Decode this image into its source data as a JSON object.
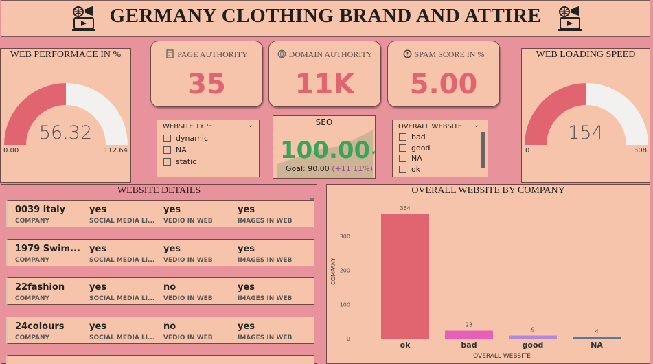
{
  "header": {
    "title": "GERMANY CLOTHING BRAND AND ATTIRE",
    "left_icon": "web-marketing-icon",
    "right_icon": "web-marketing-icon"
  },
  "web_performance": {
    "title": "WEB PERFORMACE IN %",
    "value": "56.32",
    "fraction": 0.5,
    "min": "0.00",
    "max": "112.64"
  },
  "web_loading": {
    "title": "WEB LOADING SPEED",
    "value": "154",
    "fraction": 0.5,
    "min": "0",
    "max": "308"
  },
  "kpis": [
    {
      "label": "PAGE AUTHORITY",
      "value": "35",
      "icon": "page-icon"
    },
    {
      "label": "DOMAIN AUTHORITY",
      "value": "11K",
      "icon": "globe-icon"
    },
    {
      "label": "SPAM SCORE IN %",
      "value": "5.00",
      "icon": "alert-icon"
    }
  ],
  "website_type": {
    "title": "WEBSITE TYPE",
    "options": [
      "dynamic",
      "NA",
      "static"
    ]
  },
  "overall_website": {
    "title": "OVERALL WEBSITE",
    "options": [
      "bad",
      "good",
      "NA",
      "ok"
    ]
  },
  "seo": {
    "title": "SEO",
    "value": "100.00",
    "goal_text": "Goal: 90.00",
    "delta_text": "(+11.11%)"
  },
  "details": {
    "title": "WEBSITE DETAILS",
    "labels": {
      "company": "COMPANY",
      "social": "SOCIAL MEDIA LI...",
      "video": "VEDIO IN WEB",
      "images": "IMAGES IN WEB"
    },
    "rows": [
      {
        "company": "0039 italy",
        "social": "yes",
        "video": "yes",
        "images": "yes"
      },
      {
        "company": "1979 Swim...",
        "social": "yes",
        "video": "yes",
        "images": "yes"
      },
      {
        "company": "22fashion",
        "social": "yes",
        "video": "no",
        "images": "yes"
      },
      {
        "company": "24colours",
        "social": "yes",
        "video": "no",
        "images": "yes"
      }
    ]
  },
  "colors": {
    "accent": "#e06570",
    "panel": "#f6c3ab",
    "background": "#e8939b",
    "positive": "#3aa55a"
  },
  "chart_data": {
    "type": "bar",
    "title": "OVERALL WEBSITE BY COMPANY",
    "xlabel": "OVERALL WEBSITE",
    "ylabel": "COMPANY",
    "categories": [
      "ok",
      "bad",
      "good",
      "NA"
    ],
    "values": [
      364,
      23,
      9,
      4
    ],
    "data_labels": [
      "364",
      "23",
      "9",
      "4"
    ],
    "bar_colors": [
      "#e06570",
      "#e85fb8",
      "#b08ad8",
      "#5a7a9a"
    ],
    "ylim": [
      0,
      364
    ],
    "yticks": [
      0,
      100,
      200,
      300
    ],
    "grid": false
  }
}
